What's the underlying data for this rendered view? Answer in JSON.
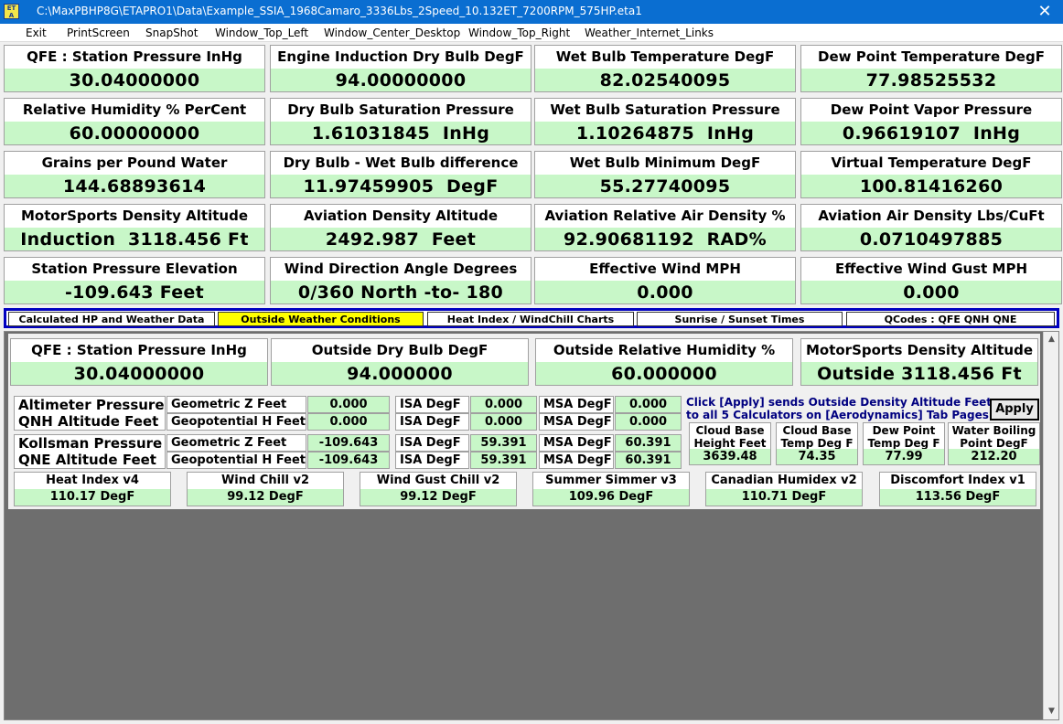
{
  "window": {
    "title": "C:\\MaxPBHP8G\\ETAPRO1\\Data\\Example_SSIA_1968Camaro_3336Lbs_2Speed_10.132ET_7200RPM_575HP.eta1",
    "icon_text": "ET A",
    "close_glyph": "✕"
  },
  "menu": [
    "Exit",
    "PrintScreen",
    "SnapShot",
    "Window_Top_Left",
    "Window_Center_Desktop",
    "Window_Top_Right",
    "Weather_Internet_Links"
  ],
  "gauges": [
    {
      "label": "QFE :  Station Pressure InHg",
      "value": "30.04000000"
    },
    {
      "label": "Engine Induction Dry Bulb DegF",
      "value": "94.00000000"
    },
    {
      "label": "Wet Bulb Temperature DegF",
      "value": "82.02540095"
    },
    {
      "label": "Dew Point Temperature DegF",
      "value": "77.98525532"
    },
    {
      "label": "Relative Humidity % PerCent",
      "value": "60.00000000"
    },
    {
      "label": "Dry Bulb Saturation Pressure",
      "value": "1.61031845  InHg"
    },
    {
      "label": "Wet Bulb Saturation Pressure",
      "value": "1.10264875  InHg"
    },
    {
      "label": "Dew Point Vapor Pressure",
      "value": "0.96619107  InHg"
    },
    {
      "label": "Grains per Pound Water",
      "value": "144.68893614"
    },
    {
      "label": "Dry Bulb - Wet Bulb   difference",
      "value": "11.97459905  DegF"
    },
    {
      "label": "Wet Bulb  Minimum  DegF",
      "value": "55.27740095"
    },
    {
      "label": "Virtual Temperature DegF",
      "value": "100.81416260"
    },
    {
      "label": "MotorSports Density Altitude",
      "value": "Induction  3118.456 Ft"
    },
    {
      "label": "Aviation Density Altitude",
      "value": "2492.987  Feet"
    },
    {
      "label": "Aviation Relative Air Density %",
      "value": "92.90681192  RAD%"
    },
    {
      "label": "Aviation Air Density Lbs/CuFt",
      "value": "0.0710497885"
    },
    {
      "label": "Station Pressure Elevation",
      "value": "-109.643 Feet"
    },
    {
      "label": "Wind Direction Angle Degrees",
      "value": "0/360 North -to- 180"
    },
    {
      "label": "Effective Wind MPH",
      "value": "0.000"
    },
    {
      "label": "Effective Wind Gust MPH",
      "value": "0.000"
    }
  ],
  "tabs": [
    {
      "label": "Calculated HP and Weather Data",
      "active": false
    },
    {
      "label": "Outside Weather Conditions",
      "active": true
    },
    {
      "label": "Heat Index / WindChill  Charts",
      "active": false
    },
    {
      "label": "Sunrise / Sunset  Times",
      "active": false
    },
    {
      "label": "QCodes :   QFE   QNH   QNE",
      "active": false
    }
  ],
  "outside": [
    {
      "label": "QFE :  Station Pressure InHg",
      "value": "30.04000000"
    },
    {
      "label": "Outside Dry Bulb DegF",
      "value": "94.000000"
    },
    {
      "label": "Outside Relative Humidity %",
      "value": "60.000000"
    },
    {
      "label": "MotorSports Density Altitude",
      "value": "Outside 3118.456 Ft"
    }
  ],
  "qnh": {
    "label1": "Altimeter Pressure",
    "label2": "QNH  Altitude Feet",
    "rows": [
      {
        "kind": "Geometric      Z Feet",
        "alt": "0.000",
        "isa_label": "ISA DegF",
        "isa": "0.000",
        "msa_label": "MSA DegF",
        "msa": "0.000"
      },
      {
        "kind": "Geopotential H Feet",
        "alt": "0.000",
        "isa_label": "ISA DegF",
        "isa": "0.000",
        "msa_label": "MSA DegF",
        "msa": "0.000"
      }
    ]
  },
  "qne": {
    "label1": "Kollsman Pressure",
    "label2": "QNE  Altitude Feet",
    "rows": [
      {
        "kind": "Geometric      Z Feet",
        "alt": "-109.643",
        "isa_label": "ISA DegF",
        "isa": "59.391",
        "msa_label": "MSA DegF",
        "msa": "60.391"
      },
      {
        "kind": "Geopotential H Feet",
        "alt": "-109.643",
        "isa_label": "ISA DegF",
        "isa": "59.391",
        "msa_label": "MSA DegF",
        "msa": "60.391"
      }
    ]
  },
  "apply_note": {
    "line1": "Click [Apply] sends Outside Density Altitude Feet",
    "line2": "to all 5 Calculators on [Aerodynamics] Tab Pages",
    "button": "Apply"
  },
  "mini": [
    {
      "label": "Cloud Base\nHeight Feet",
      "value": "3639.48"
    },
    {
      "label": "Cloud Base\nTemp Deg F",
      "value": "74.35"
    },
    {
      "label": "Dew Point\nTemp Deg F",
      "value": "77.99"
    },
    {
      "label": "Water Boiling\nPoint DegF",
      "value": "212.20"
    }
  ],
  "indices": [
    {
      "label": "Heat Index  v4",
      "value": "110.17  DegF"
    },
    {
      "label": "Wind Chill  v2",
      "value": "99.12  DegF"
    },
    {
      "label": "Wind Gust Chill  v2",
      "value": "99.12  DegF"
    },
    {
      "label": "Summer Simmer  v3",
      "value": "109.96  DegF"
    },
    {
      "label": "Canadian Humidex  v2",
      "value": "110.71  DegF"
    },
    {
      "label": "Discomfort Index  v1",
      "value": "113.56  DegF"
    }
  ],
  "scroll": {
    "up": "▲",
    "down": "▼"
  },
  "colors": {
    "titlebar": "#0a6ed1",
    "value_bg": "#c8f7c8",
    "active_tab": "#ffff00",
    "tab_border": "#0000c0",
    "note": "#000080"
  }
}
